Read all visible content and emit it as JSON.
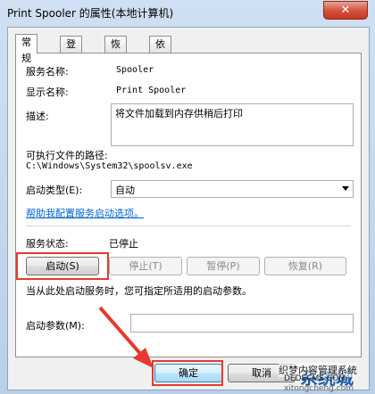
{
  "window": {
    "title": "Print Spooler 的属性(本地计算机)",
    "close_glyph": "✕"
  },
  "tabs": [
    "常规",
    "登录",
    "恢复",
    "依存关系"
  ],
  "general": {
    "service_name_label": "服务名称:",
    "service_name": "Spooler",
    "display_name_label": "显示名称:",
    "display_name": "Print Spooler",
    "description_label": "描述:",
    "description": "将文件加载到内存供稍后打印",
    "path_label": "可执行文件的路径:",
    "path": "C:\\Windows\\System32\\spoolsv.exe",
    "startup_type_label": "启动类型(E):",
    "startup_type": "自动",
    "help_link": "帮助我配置服务启动选项。",
    "status_label": "服务状态:",
    "status": "已停止",
    "start_button": "启动(S)",
    "stop_button": "停止(T)",
    "pause_button": "暂停(P)",
    "resume_button": "恢复(R)",
    "hint": "当从此处启动服务时，您可指定所适用的启动参数。",
    "params_label": "启动参数(M):",
    "params_value": ""
  },
  "footer": {
    "ok_button": "确定",
    "cancel_button": "取消"
  },
  "watermark": {
    "line1": "系统城",
    "line2": "织梦内容管理系统",
    "line3": "DEDECMS.COM",
    "line4": "xitongcheng.com"
  },
  "colors": {
    "highlight": "#e53a2f",
    "link": "#0066cc"
  }
}
